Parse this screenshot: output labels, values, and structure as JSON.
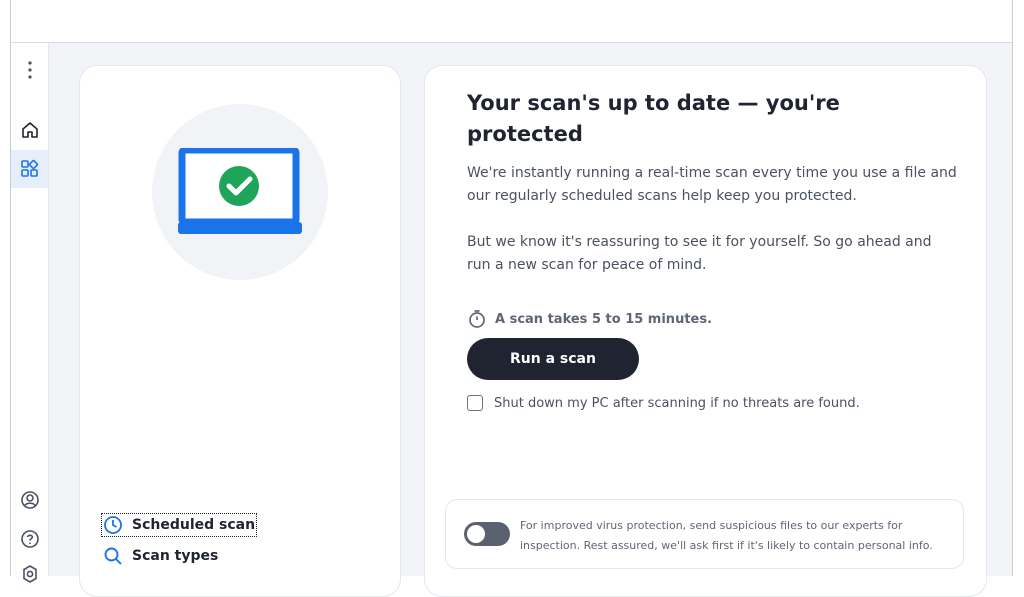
{
  "sidebar": {
    "items": [
      {
        "icon": "more-vertical-icon"
      },
      {
        "icon": "home-icon"
      },
      {
        "icon": "dashboard-icon",
        "active": true
      },
      {
        "icon": "account-icon"
      },
      {
        "icon": "help-icon"
      },
      {
        "icon": "settings-icon"
      }
    ]
  },
  "left_panel": {
    "illustration": "laptop-check-icon",
    "links": [
      {
        "label": "Scheduled scan",
        "icon": "clock-icon",
        "focused": true
      },
      {
        "label": "Scan types",
        "icon": "search-icon"
      }
    ]
  },
  "main": {
    "heading": "Your scan's up to date — you're protected",
    "paragraph1": "We're instantly running a real-time scan every time you use a file and our regularly scheduled scans help keep you protected.",
    "paragraph2": "But we know it's reassuring to see it for yourself. So go ahead and run a new scan for peace of mind.",
    "scan_time": "A scan takes 5 to 15 minutes.",
    "run_button": "Run a scan",
    "shutdown_checkbox_label": "Shut down my PC after scanning if no threats are found.",
    "shutdown_checked": false,
    "toggle_text": "For improved virus protection, send suspicious files to our experts for inspection. Rest assured, we'll ask first if it's likely to contain personal info.",
    "toggle_on": false
  },
  "colors": {
    "accent": "#1a73e8",
    "success": "#1fa55a",
    "dark_button": "#1f2430",
    "background": "#f2f4f7"
  }
}
